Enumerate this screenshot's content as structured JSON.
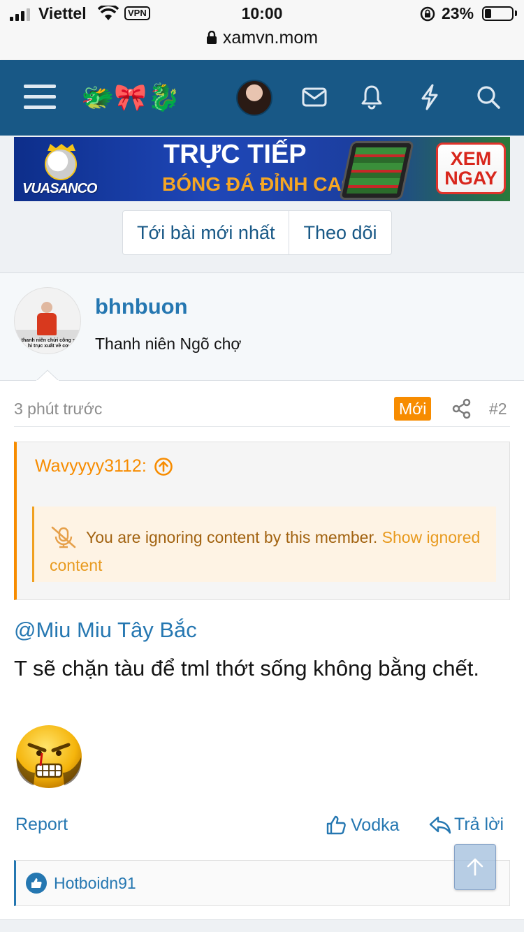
{
  "status_bar": {
    "carrier": "Viettel",
    "vpn_label": "VPN",
    "time": "10:00",
    "battery_text": "23%",
    "battery_level": 0.23,
    "url": "xamvn.mom"
  },
  "navbar": {
    "logo_glyphs": "🐲🎀🐉",
    "icons": [
      "menu-icon",
      "avatar",
      "mail-icon",
      "bell-icon",
      "lightning-icon",
      "search-icon"
    ],
    "color": "#185886"
  },
  "banner": {
    "brand": "VUASANCO",
    "title_line1": "TRỰC TIẾP",
    "title_line2": "BÓNG ĐÁ ĐỈNH CAO",
    "cta_line1": "XEM",
    "cta_line2": "NGAY"
  },
  "thread_buttons": {
    "latest": "Tới bài mới nhất",
    "follow": "Theo dõi"
  },
  "post": {
    "author": {
      "name": "bhnbuon",
      "title": "Thanh niên Ngõ chợ",
      "avatar_caption": "t thanh niên chửi công sả  hi trục  xuất về cơ"
    },
    "time": "3 phút trước",
    "new_badge": "Mới",
    "number": "#2",
    "quote": {
      "author": "Wavyyyy3112:",
      "ignored_text": "You are ignoring content by this member.",
      "ignored_link": "Show ignored content"
    },
    "mention": "@Miu Miu Tây Bắc",
    "message": "T sẽ chặn tàu để tml thớt sống không bằng chết.",
    "actions": {
      "report": "Report",
      "like": "Vodka",
      "reply": "Trả lời"
    },
    "reactions": {
      "users": "Hotboidn91"
    }
  },
  "colors": {
    "brand_blue": "#185886",
    "link_blue": "#2577b1",
    "orange": "#f78c00"
  }
}
